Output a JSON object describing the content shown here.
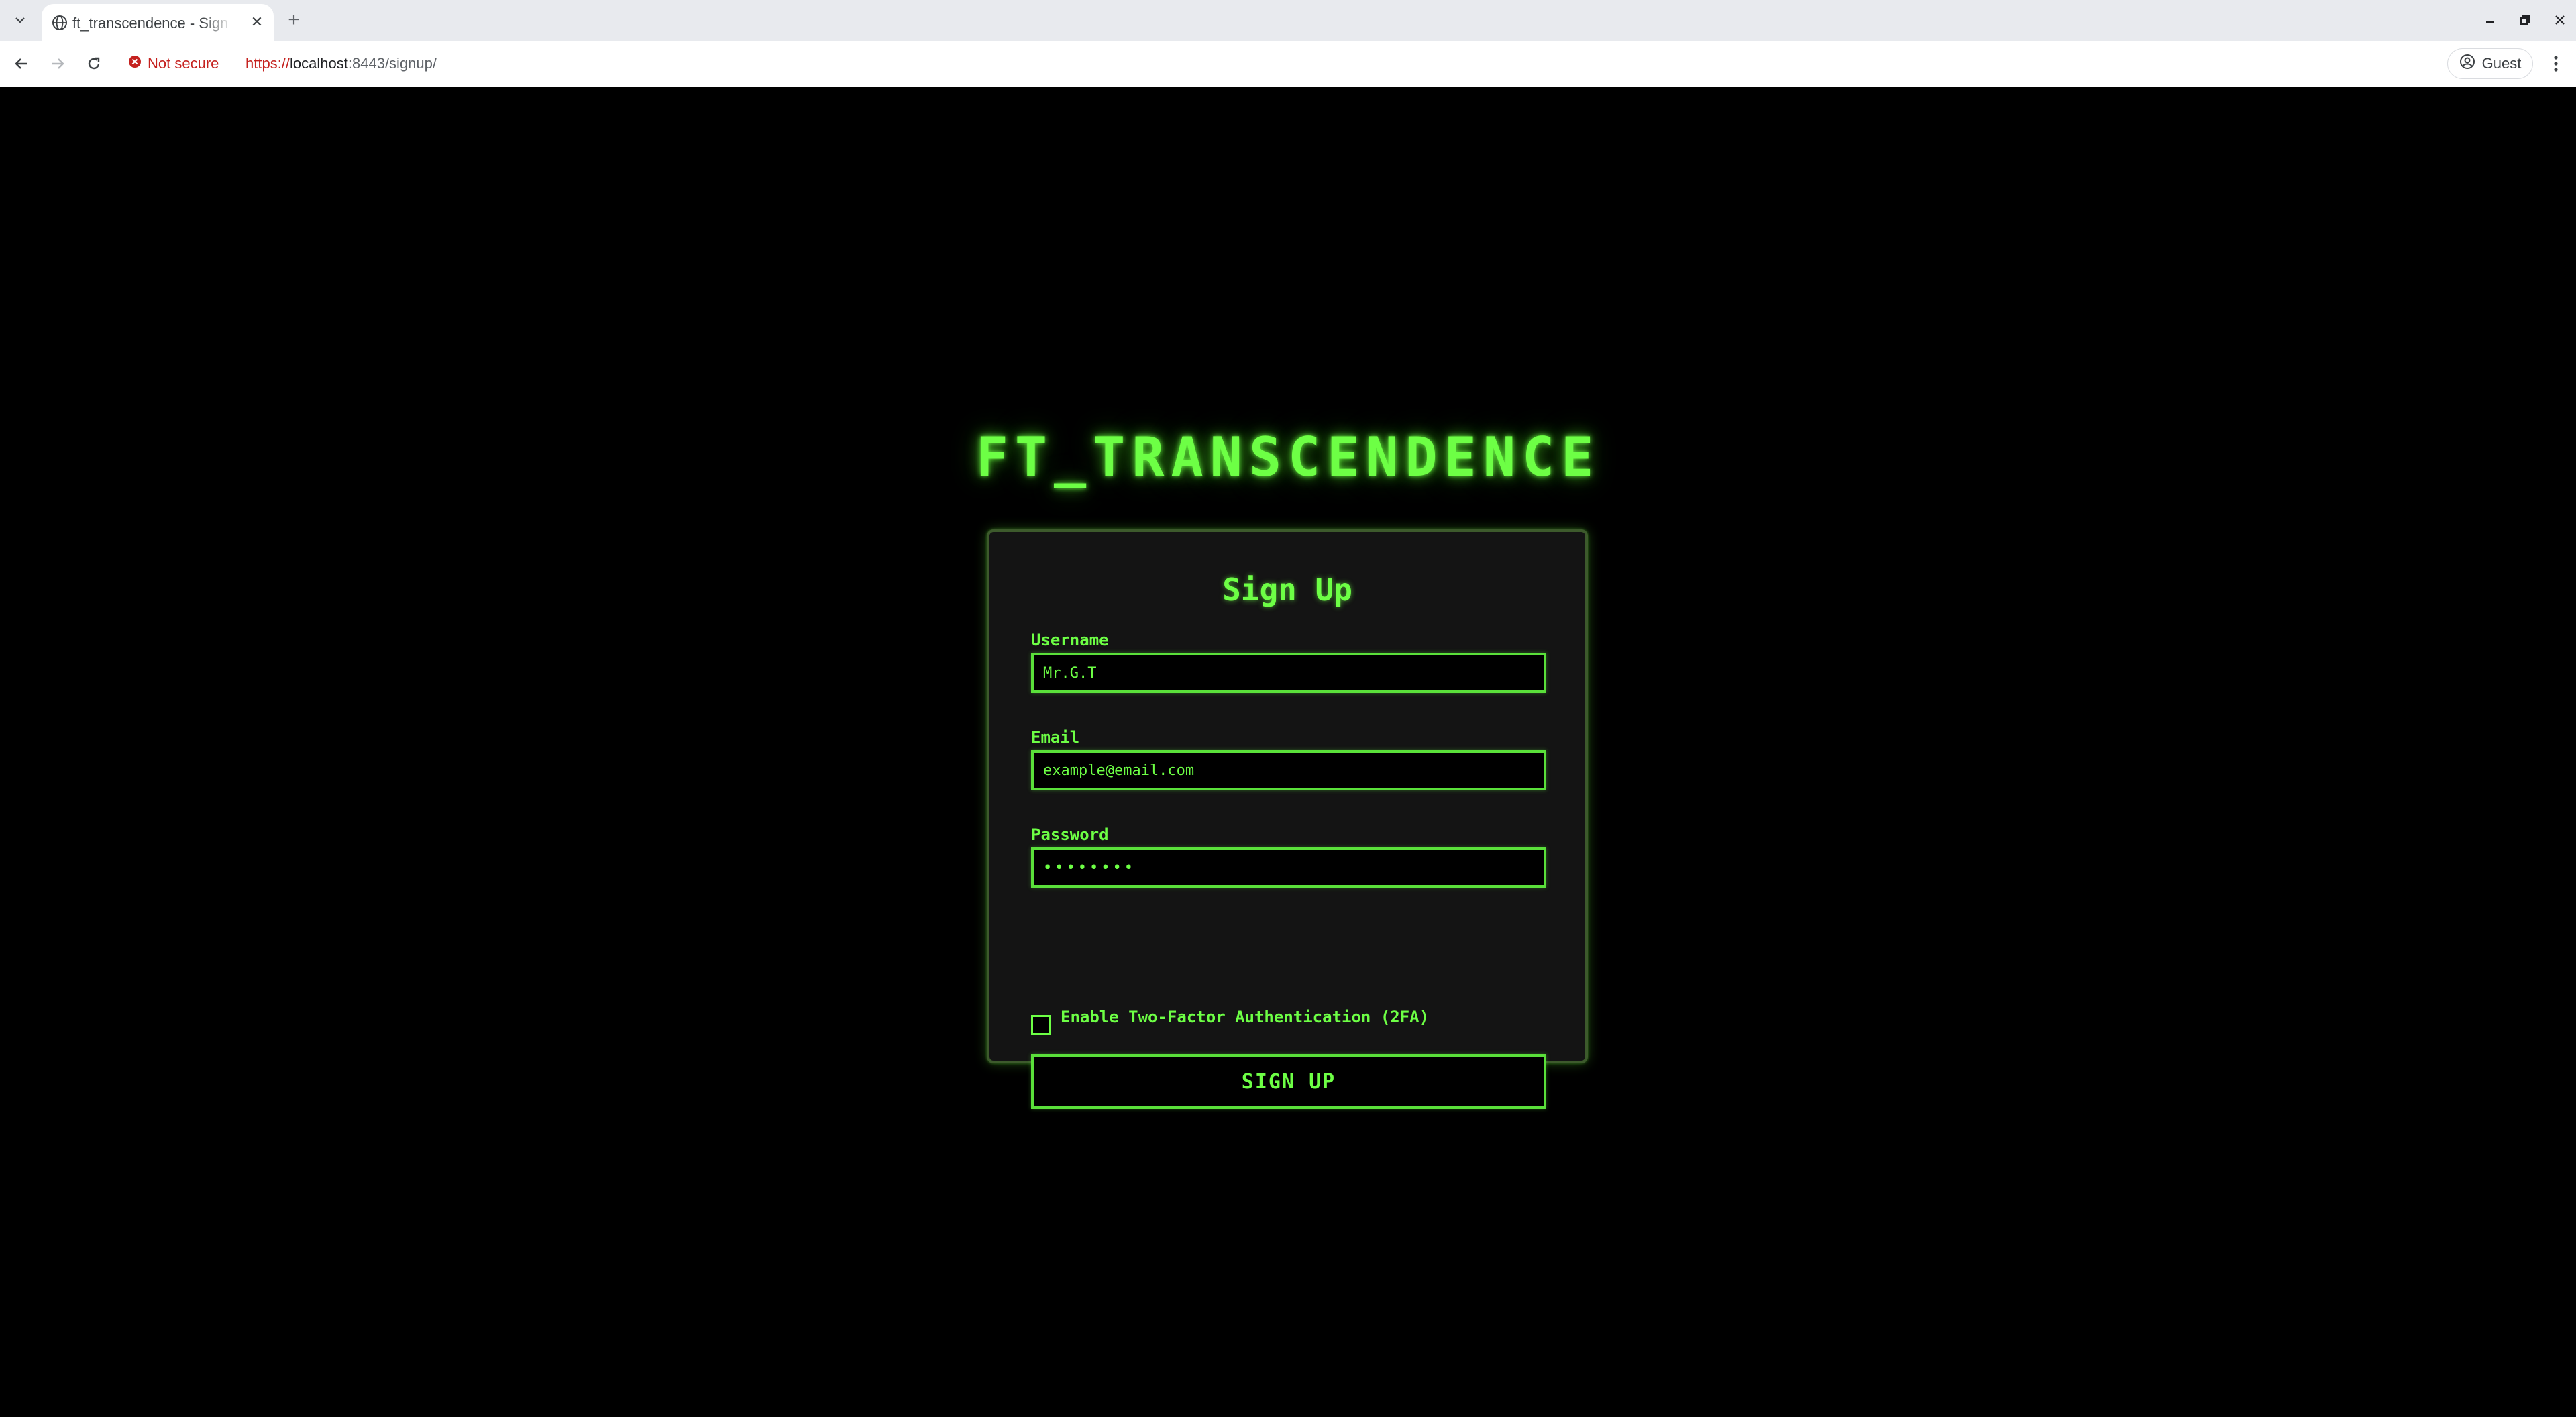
{
  "browser": {
    "tab": {
      "title": "ft_transcendence - Sign Up"
    },
    "security_label": "Not secure",
    "url": {
      "scheme": "https://",
      "host": "localhost",
      "rest": ":8443/signup/"
    },
    "profile_label": "Guest"
  },
  "page": {
    "site_title": "FT_TRANSCENDENCE",
    "form": {
      "heading": "Sign Up",
      "username": {
        "label": "Username",
        "value": "Mr.G.T"
      },
      "email": {
        "label": "Email",
        "placeholder": "example@email.com"
      },
      "password": {
        "label": "Password",
        "value": "••••••••"
      },
      "twofa": {
        "label": "Enable Two-Factor Authentication (2FA)",
        "checked": false
      },
      "submit_label": "SIGN UP"
    }
  },
  "colors": {
    "accent": "#6dff45",
    "background": "#000000",
    "card": "#141414"
  }
}
